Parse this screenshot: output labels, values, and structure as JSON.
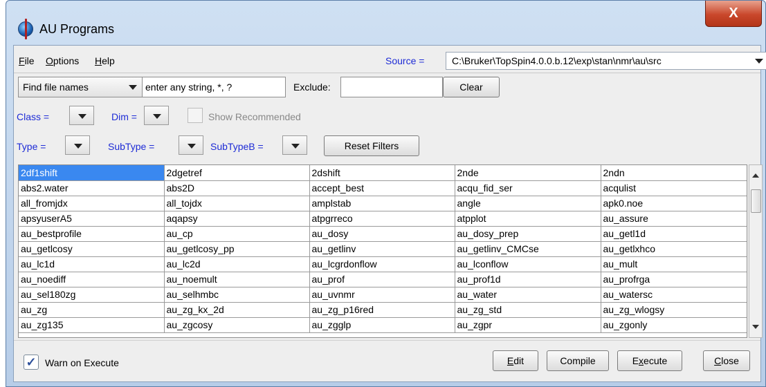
{
  "window": {
    "title": "AU Programs",
    "close_glyph": "X"
  },
  "menu": [
    {
      "label": "File",
      "mnemonic": "F"
    },
    {
      "label": "Options",
      "mnemonic": "O"
    },
    {
      "label": "Help",
      "mnemonic": "H"
    }
  ],
  "source": {
    "label": "Source =",
    "value": "C:\\Bruker\\TopSpin4.0.0.b.12\\exp\\stan\\nmr\\au\\src"
  },
  "search": {
    "mode": "Find file names",
    "value": "enter any string, *, ?",
    "exclude_label": "Exclude:",
    "exclude_value": "",
    "clear_label": "Clear"
  },
  "filters": {
    "class_label": "Class =",
    "dim_label": "Dim =",
    "show_recommended_label": "Show Recommended",
    "type_label": "Type =",
    "subtype_label": "SubType =",
    "subtypeb_label": "SubTypeB =",
    "reset_label": "Reset Filters"
  },
  "table": {
    "selected_cell": "2df1shift",
    "rows": [
      [
        "2df1shift",
        "2dgetref",
        "2dshift",
        "2nde",
        "2ndn"
      ],
      [
        "abs2.water",
        "abs2D",
        "accept_best",
        "acqu_fid_ser",
        "acqulist"
      ],
      [
        "all_fromjdx",
        "all_tojdx",
        "amplstab",
        "angle",
        "apk0.noe"
      ],
      [
        "apsyuserA5",
        "aqapsy",
        "atpgrreco",
        "atpplot",
        "au_assure"
      ],
      [
        "au_bestprofile",
        "au_cp",
        "au_dosy",
        "au_dosy_prep",
        "au_getl1d"
      ],
      [
        "au_getlcosy",
        "au_getlcosy_pp",
        "au_getlinv",
        "au_getlinv_CMCse",
        "au_getlxhco"
      ],
      [
        "au_lc1d",
        "au_lc2d",
        "au_lcgrdonflow",
        "au_lconflow",
        "au_mult"
      ],
      [
        "au_noediff",
        "au_noemult",
        "au_prof",
        "au_prof1d",
        "au_profrga"
      ],
      [
        "au_sel180zg",
        "au_selhmbc",
        "au_uvnmr",
        "au_water",
        "au_watersc"
      ],
      [
        "au_zg",
        "au_zg_kx_2d",
        "au_zg_p16red",
        "au_zg_std",
        "au_zg_wlogsy"
      ],
      [
        "au_zg135",
        "au_zgcosy",
        "au_zgglp",
        "au_zgpr",
        "au_zgonly"
      ]
    ]
  },
  "footer": {
    "warn_label": "Warn on Execute",
    "warn_checked": true,
    "edit_label": "Edit",
    "compile_label": "Compile",
    "execute_label": "Execute",
    "close_label": "Close"
  },
  "colors": {
    "blue_label": "#1d2bd6",
    "selection": "#3a88f0",
    "close_button": "#c9472b"
  },
  "icons": {
    "app": "topspin-app-icon",
    "dropdown": "chevron-down-icon",
    "check": "checkmark-icon"
  }
}
